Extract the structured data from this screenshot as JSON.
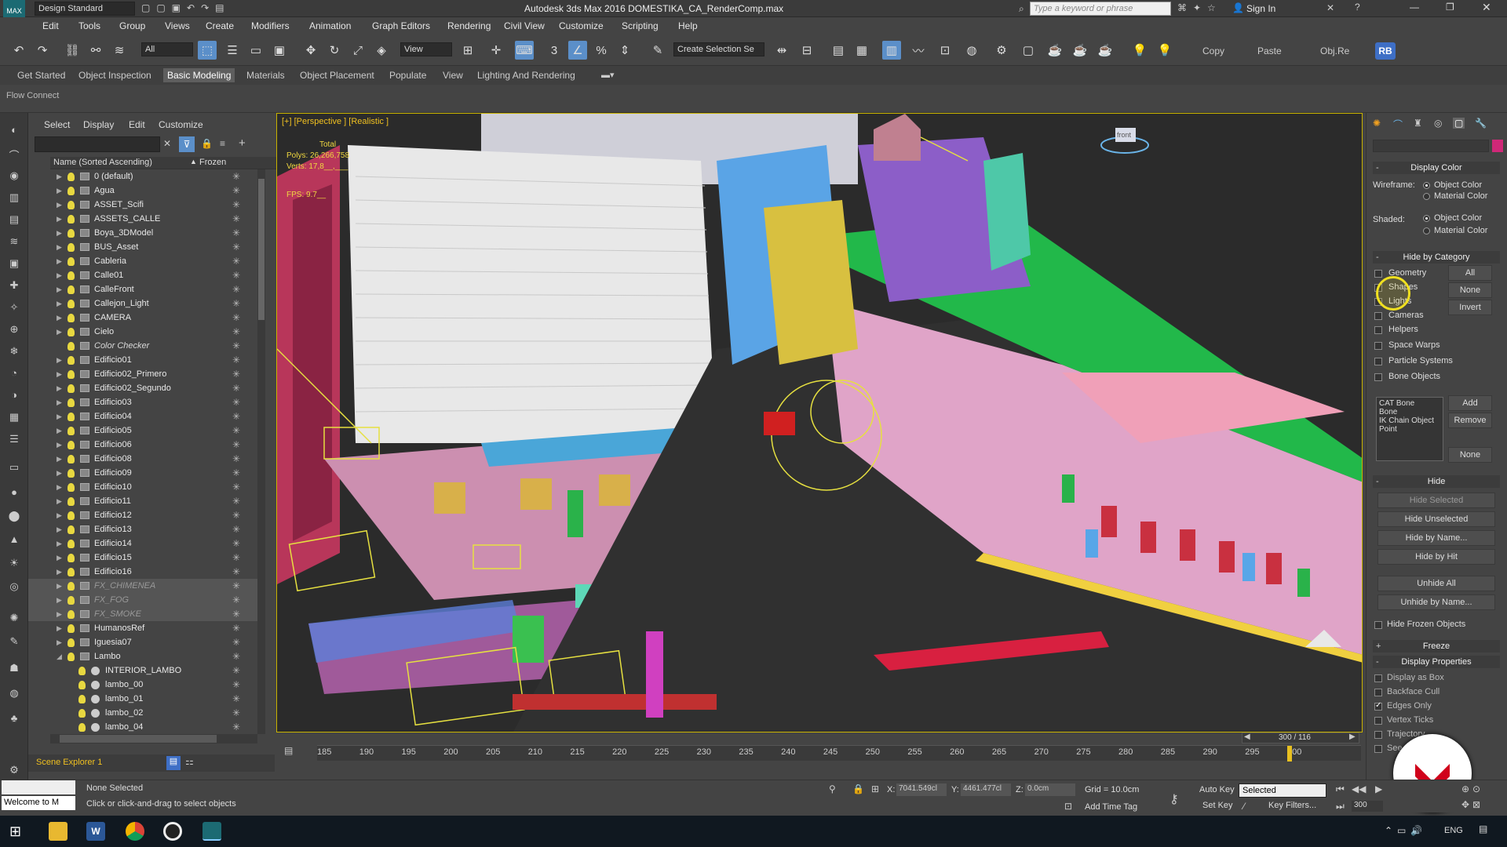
{
  "title_bar": {
    "workspace": "Design Standard",
    "title": "Autodesk 3ds Max 2016    DOMESTIKA_CA_RenderComp.max",
    "search_placeholder": "Type a keyword or phrase",
    "sign_in": "Sign In"
  },
  "menu": [
    "Edit",
    "Tools",
    "Group",
    "Views",
    "Create",
    "Modifiers",
    "Animation",
    "Graph Editors",
    "Rendering",
    "Civil View",
    "Customize",
    "Scripting",
    "Help"
  ],
  "toolbar": {
    "filter": "All",
    "ref_coord": "View",
    "selection_set": "Create Selection Se",
    "copy": "Copy",
    "paste": "Paste",
    "objre": "Obj.Re",
    "rb": "RB"
  },
  "ribbon_tabs": [
    "Get Started",
    "Object Inspection",
    "Basic Modeling",
    "Materials",
    "Object Placement",
    "Populate",
    "View",
    "Lighting And Rendering"
  ],
  "ribbon_active": "Basic Modeling",
  "flow_connect": "Flow Connect",
  "explorer": {
    "menu": [
      "Select",
      "Display",
      "Edit",
      "Customize"
    ],
    "col_name": "Name (Sorted Ascending)",
    "col_frozen": "Frozen",
    "footer": "Scene Explorer 1",
    "rows": [
      {
        "name": "0 (default)",
        "type": "layer",
        "exp": true
      },
      {
        "name": "Agua",
        "type": "layer",
        "exp": true
      },
      {
        "name": "ASSET_Scifi",
        "type": "layer",
        "exp": true
      },
      {
        "name": "ASSETS_CALLE",
        "type": "layer",
        "exp": true
      },
      {
        "name": "Boya_3DModel",
        "type": "layer",
        "exp": true
      },
      {
        "name": "BUS_Asset",
        "type": "layer",
        "exp": true
      },
      {
        "name": "Cableria",
        "type": "layer",
        "exp": true
      },
      {
        "name": "Calle01",
        "type": "layer",
        "exp": true
      },
      {
        "name": "CalleFront",
        "type": "layer",
        "exp": true
      },
      {
        "name": "Callejon_Light",
        "type": "layer",
        "exp": true
      },
      {
        "name": "CAMERA",
        "type": "layer",
        "exp": true
      },
      {
        "name": "Cielo",
        "type": "layer",
        "exp": true
      },
      {
        "name": "Color Checker",
        "type": "layer",
        "exp": false,
        "style": "ital"
      },
      {
        "name": "Edificio01",
        "type": "layer",
        "exp": true
      },
      {
        "name": "Edificio02_Primero",
        "type": "layer",
        "exp": true
      },
      {
        "name": "Edificio02_Segundo",
        "type": "layer",
        "exp": true
      },
      {
        "name": "Edificio03",
        "type": "layer",
        "exp": true
      },
      {
        "name": "Edificio04",
        "type": "layer",
        "exp": true
      },
      {
        "name": "Edificio05",
        "type": "layer",
        "exp": true
      },
      {
        "name": "Edificio06",
        "type": "layer",
        "exp": true
      },
      {
        "name": "Edificio08",
        "type": "layer",
        "exp": true
      },
      {
        "name": "Edificio09",
        "type": "layer",
        "exp": true
      },
      {
        "name": "Edificio10",
        "type": "layer",
        "exp": true
      },
      {
        "name": "Edificio11",
        "type": "layer",
        "exp": true
      },
      {
        "name": "Edificio12",
        "type": "layer",
        "exp": true
      },
      {
        "name": "Edificio13",
        "type": "layer",
        "exp": true
      },
      {
        "name": "Edificio14",
        "type": "layer",
        "exp": true
      },
      {
        "name": "Edificio15",
        "type": "layer",
        "exp": true
      },
      {
        "name": "Edificio16",
        "type": "layer",
        "exp": true
      },
      {
        "name": "FX_CHIMENEA",
        "type": "layer",
        "exp": true,
        "style": "hid"
      },
      {
        "name": "FX_FOG",
        "type": "layer",
        "exp": true,
        "style": "hid"
      },
      {
        "name": "FX_SMOKE",
        "type": "layer",
        "exp": true,
        "style": "hid"
      },
      {
        "name": "HumanosRef",
        "type": "layer",
        "exp": true
      },
      {
        "name": "Iguesia07",
        "type": "layer",
        "exp": true
      },
      {
        "name": "Lambo",
        "type": "layer",
        "exp": true,
        "open": true
      },
      {
        "name": "INTERIOR_LAMBO",
        "type": "obj",
        "exp": false
      },
      {
        "name": "lambo_00",
        "type": "obj",
        "exp": false
      },
      {
        "name": "lambo_01",
        "type": "obj",
        "exp": false
      },
      {
        "name": "lambo_02",
        "type": "obj",
        "exp": false
      },
      {
        "name": "lambo_04",
        "type": "obj",
        "exp": false
      }
    ]
  },
  "viewport": {
    "label": "[+] [Perspective ] [Realistic ]",
    "stats_total": "Total",
    "stats_polys": "Polys:  26,266,758",
    "stats_verts": "Verts:  17,8__,___",
    "fps": "FPS:   9.7__",
    "viewcube": "front"
  },
  "command_panel": {
    "display_color": "Display Color",
    "wireframe": "Wireframe:",
    "shaded": "Shaded:",
    "object_color": "Object Color",
    "material_color": "Material Color",
    "hide_by_category": "Hide by Category",
    "categories": [
      "Geometry",
      "Shapes",
      "Lights",
      "Cameras",
      "Helpers",
      "Space Warps",
      "Particle Systems",
      "Bone Objects"
    ],
    "btn_all": "All",
    "btn_none": "None",
    "btn_invert": "Invert",
    "bone_list": [
      "CAT Bone",
      "Bone",
      "IK Chain Object",
      "Point"
    ],
    "btn_add": "Add",
    "btn_remove": "Remove",
    "btn_none2": "None",
    "hide": "Hide",
    "hide_selected": "Hide Selected",
    "hide_unselected": "Hide Unselected",
    "hide_by_name": "Hide by Name...",
    "hide_by_hit": "Hide by Hit",
    "unhide_all": "Unhide All",
    "unhide_by_name": "Unhide by Name...",
    "hide_frozen": "Hide Frozen Objects",
    "freeze": "Freeze",
    "display_properties": "Display Properties",
    "props": [
      {
        "label": "Display as Box",
        "on": false
      },
      {
        "label": "Backface Cull",
        "on": false
      },
      {
        "label": "Edges Only",
        "on": true
      },
      {
        "label": "Vertex Ticks",
        "on": false
      },
      {
        "label": "Trajectory",
        "on": false
      },
      {
        "label": "See-Through",
        "on": false
      }
    ]
  },
  "timeline": {
    "slider": "300 / 116",
    "ticks": [
      "185",
      "190",
      "195",
      "200",
      "205",
      "210",
      "215",
      "220",
      "225",
      "230",
      "235",
      "240",
      "245",
      "250",
      "255",
      "260",
      "265",
      "270",
      "275",
      "280",
      "285",
      "290",
      "295",
      "300"
    ]
  },
  "status": {
    "welcome": "Welcome to M",
    "none_selected": "None Selected",
    "prompt": "Click or click-and-drag to select objects",
    "x_label": "X:",
    "x_val": "7041.549cl",
    "y_label": "Y:",
    "y_val": "4461.477cl",
    "z_label": "Z:",
    "z_val": "0.0cm",
    "grid": "Grid = 10.0cm",
    "add_time_tag": "Add Time Tag",
    "auto_key": "Auto Key",
    "selected": "Selected",
    "set_key": "Set Key",
    "key_filters": "Key Filters...",
    "frame": "300"
  },
  "taskbar": {
    "lang": "ENG"
  },
  "colors": {
    "accent": "#5b8fc9",
    "viewport_border": "#c8b200",
    "logo_red": "#d0021b"
  }
}
